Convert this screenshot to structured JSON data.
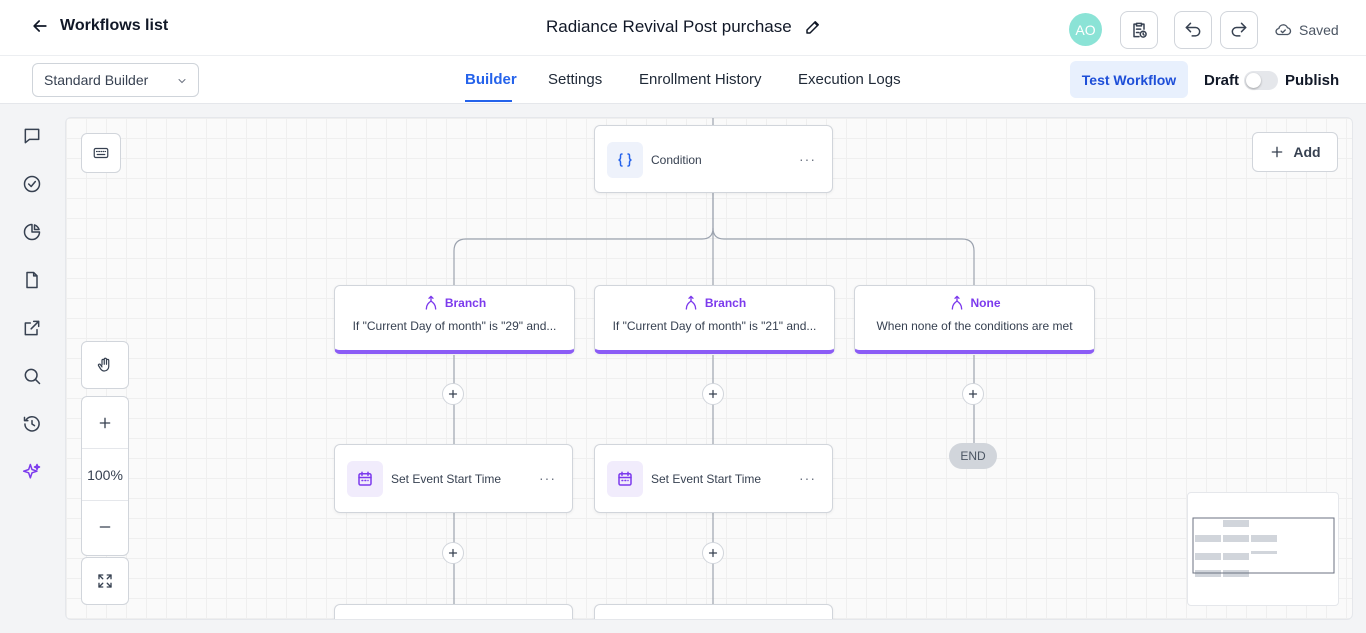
{
  "header": {
    "back_label": "Workflows list",
    "workflow_title": "Radiance Revival Post purchase",
    "avatar_initials": "AO",
    "saved_label": "Saved"
  },
  "toolbar": {
    "builder_select_value": "Standard Builder",
    "tabs": [
      {
        "label": "Builder",
        "active": true
      },
      {
        "label": "Settings",
        "active": false
      },
      {
        "label": "Enrollment History",
        "active": false
      },
      {
        "label": "Execution Logs",
        "active": false
      }
    ],
    "test_label": "Test Workflow",
    "draft_label": "Draft",
    "publish_label": "Publish",
    "publish_toggle_on": false
  },
  "sidebar": {
    "icons": [
      "chat-icon",
      "check-circle-icon",
      "pie-chart-icon",
      "document-icon",
      "external-link-icon",
      "search-icon",
      "history-icon",
      "sparkles-icon"
    ]
  },
  "canvas": {
    "add_label": "Add",
    "zoom_level": "100%",
    "condition": {
      "label": "Condition",
      "icon": "braces-icon"
    },
    "branches": [
      {
        "title": "Branch",
        "description": "If \"Current Day of month\" is \"29\" and..."
      },
      {
        "title": "Branch",
        "description": "If \"Current Day of month\" is \"21\" and..."
      },
      {
        "title": "None",
        "description": "When none of the conditions are met"
      }
    ],
    "actions": [
      {
        "label": "Set Event Start Time",
        "icon": "calendar-icon"
      },
      {
        "label": "Set Event Start Time",
        "icon": "calendar-icon"
      }
    ],
    "end_label": "END",
    "more_label": "···"
  },
  "colors": {
    "accent": "#2563eb",
    "branch_purple": "#8b5cf6",
    "avatar": "#8be3d6"
  }
}
